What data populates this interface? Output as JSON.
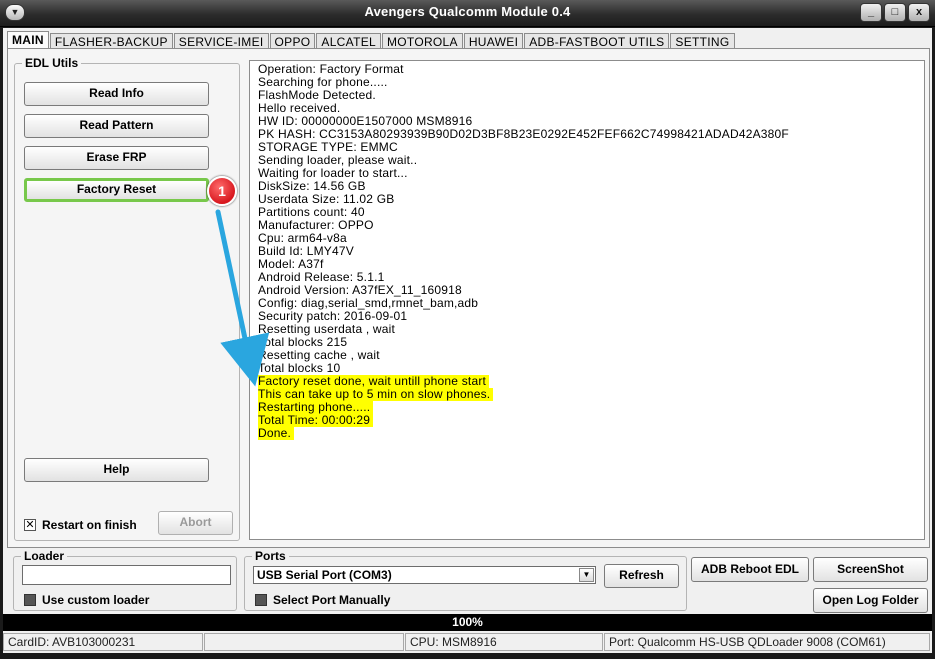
{
  "window": {
    "title": "Avengers Qualcomm Module 0.4",
    "controls": {
      "minimize": "_",
      "maximize": "□",
      "close": "x"
    }
  },
  "tabs": [
    {
      "label": "MAIN",
      "active": true
    },
    {
      "label": "FLASHER-BACKUP"
    },
    {
      "label": "SERVICE-IMEI"
    },
    {
      "label": "OPPO"
    },
    {
      "label": "ALCATEL"
    },
    {
      "label": "MOTOROLA"
    },
    {
      "label": "HUAWEI"
    },
    {
      "label": "ADB-FASTBOOT UTILS"
    },
    {
      "label": "SETTING"
    }
  ],
  "edl": {
    "title": "EDL Utils",
    "read_info": "Read Info",
    "read_pattern": "Read Pattern",
    "erase_frp": "Erase FRP",
    "factory_reset": "Factory Reset",
    "step_badge": "1",
    "help": "Help",
    "restart_label": "Restart on finish",
    "restart_checked": true,
    "abort": "Abort"
  },
  "log": {
    "lines": [
      "Operation: Factory Format",
      "Searching for phone.....",
      "FlashMode Detected.",
      "Hello received.",
      "HW ID: 00000000E1507000 MSM8916",
      "PK HASH: CC3153A80293939B90D02D3BF8B23E0292E452FEF662C74998421ADAD42A380F",
      "STORAGE TYPE: EMMC",
      "Sending loader, please wait..",
      "Waiting for loader to start...",
      "DiskSize: 14.56 GB",
      "Userdata Size: 11.02 GB",
      "Partitions count: 40",
      "Manufacturer: OPPO",
      "Cpu: arm64-v8a",
      "Build Id: LMY47V",
      "Model: A37f",
      "Android Release: 5.1.1",
      "Android Version: A37fEX_11_160918",
      "Config: diag,serial_smd,rmnet_bam,adb",
      "Security patch: 2016-09-01",
      "Resetting userdata , wait",
      "Total blocks 215",
      "Resetting cache , wait",
      "Total blocks 10"
    ],
    "highlighted": [
      "Factory reset done, wait untill phone start",
      "This can take up to 5 min on slow phones.",
      "Restarting phone.....",
      "Total Time: 00:00:29",
      "Done."
    ],
    "highlight_color": "#ffff00"
  },
  "loader": {
    "title": "Loader",
    "path_value": "",
    "custom_label": "Use custom loader",
    "custom_checked": false
  },
  "ports": {
    "title": "Ports",
    "selected": "USB Serial Port (COM3)",
    "refresh": "Refresh",
    "manual_label": "Select Port Manually",
    "manual_checked": false
  },
  "actions": {
    "adb_reboot_edl": "ADB Reboot EDL",
    "screenshot": "ScreenShot",
    "open_log_folder": "Open Log Folder"
  },
  "progress": {
    "label": "100%",
    "value": 100
  },
  "status": {
    "card_id": "CardID: AVB103000231",
    "blank": "",
    "cpu": "CPU: MSM8916",
    "port": "Port: Qualcomm HS-USB QDLoader 9008 (COM61)"
  },
  "colors": {
    "accent_green": "#78c84b",
    "badge_red": "#d8181f",
    "arrow_blue": "#2aa6df"
  }
}
